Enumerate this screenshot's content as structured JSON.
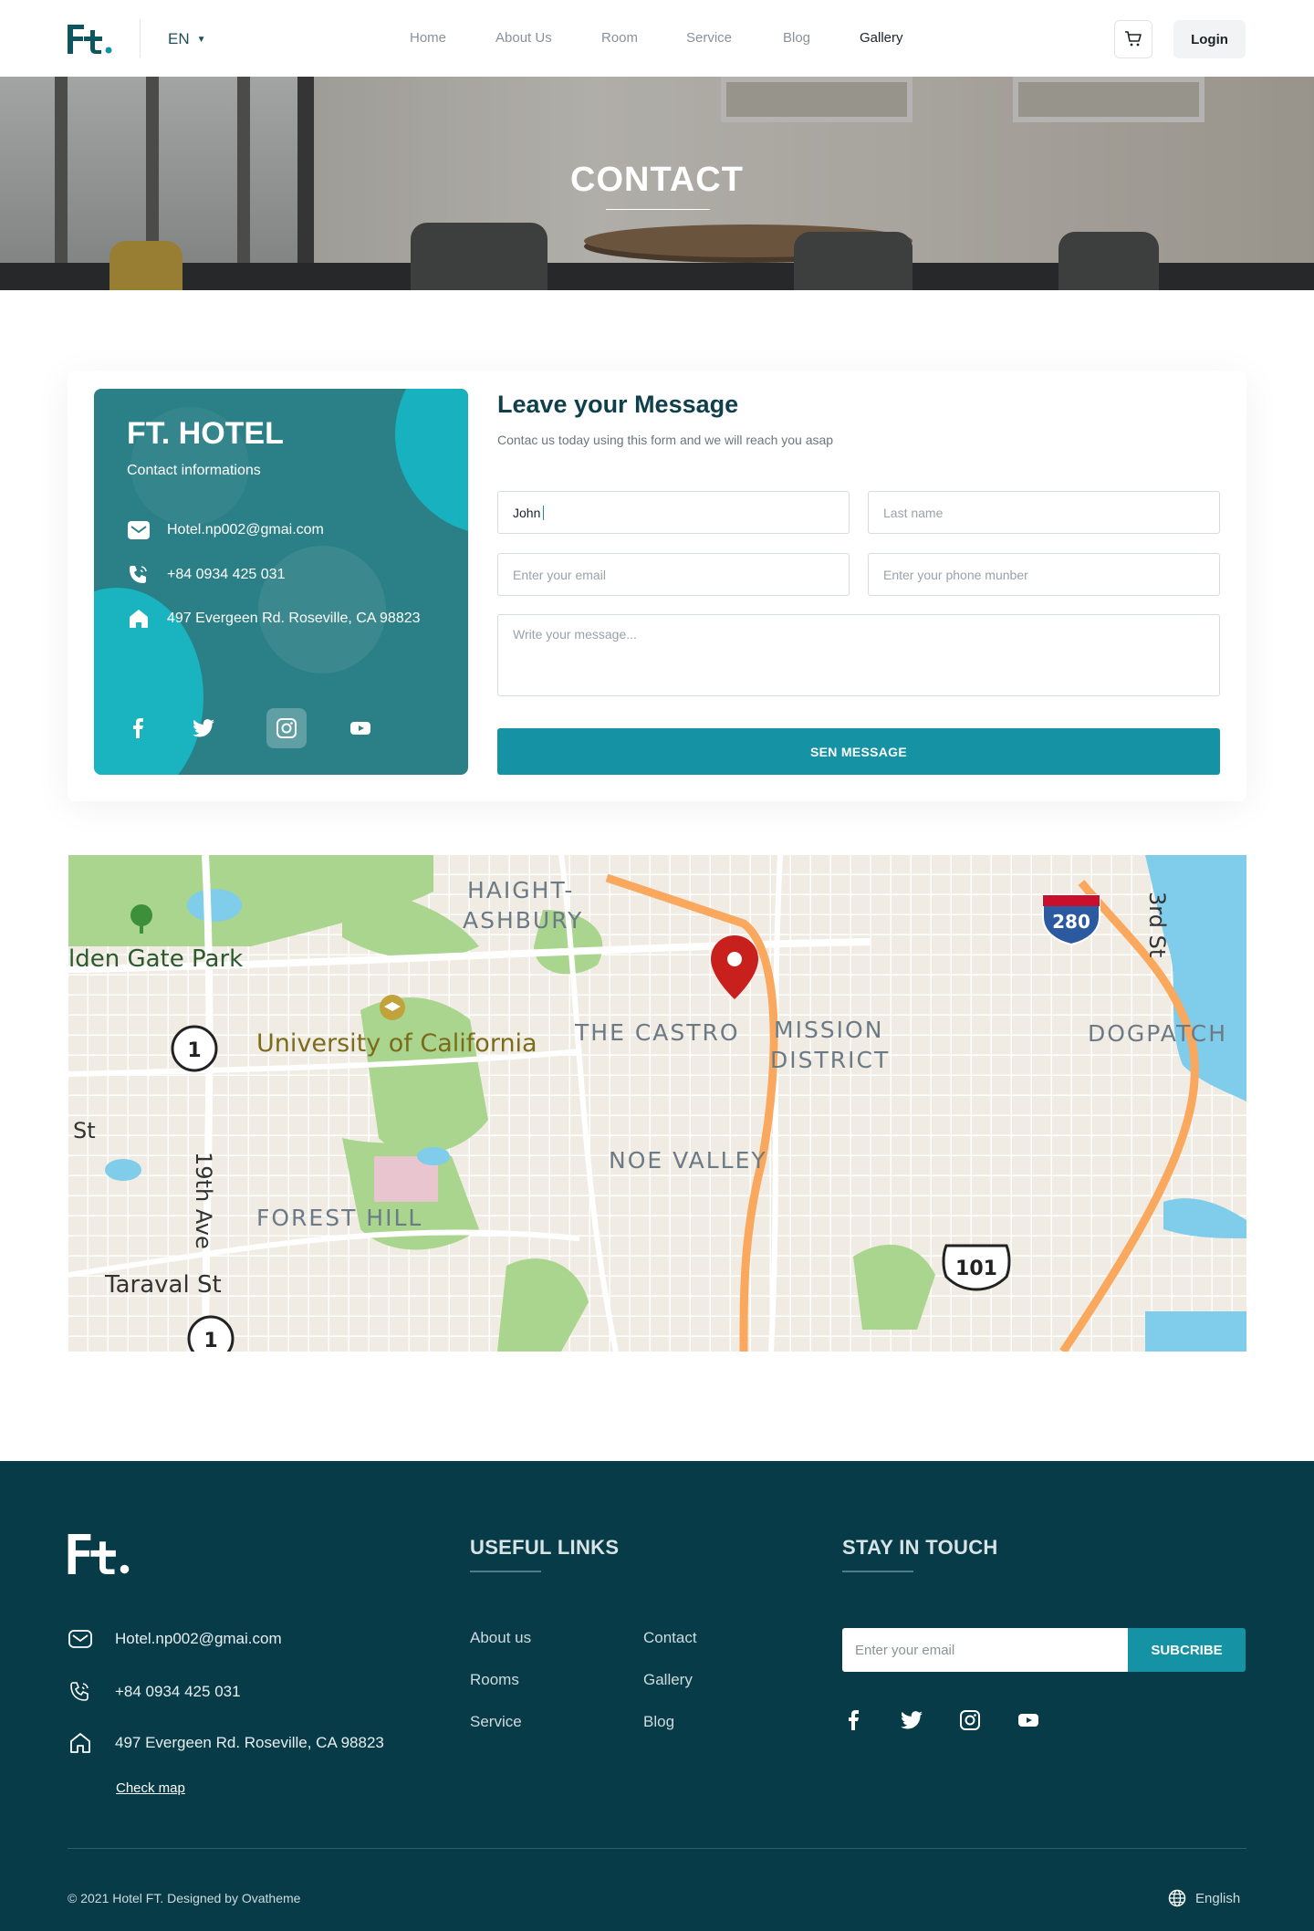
{
  "brand": {
    "logo_text": "Ft."
  },
  "header": {
    "language": "EN",
    "nav": [
      {
        "label": "Home",
        "active": false
      },
      {
        "label": "About Us",
        "active": false
      },
      {
        "label": "Room",
        "active": false
      },
      {
        "label": "Service",
        "active": false
      },
      {
        "label": "Blog",
        "active": false
      },
      {
        "label": "Gallery",
        "active": true
      }
    ],
    "cart_icon": "cart-icon",
    "login_label": "Login"
  },
  "hero": {
    "title": "CONTACT"
  },
  "contact_card": {
    "title": "FT. HOTEL",
    "subtitle": "Contact informations",
    "email": "Hotel.np002@gmai.com",
    "phone": "+84 0934 425 031",
    "address": "497 Evergeen Rd. Roseville, CA 98823",
    "social": [
      "facebook-icon",
      "twitter-icon",
      "instagram-icon",
      "youtube-icon"
    ],
    "active_social": "instagram-icon"
  },
  "form": {
    "title": "Leave your Message",
    "subtitle": "Contac us today using this form and we will reach you asap",
    "first_name_value": "John",
    "last_name_placeholder": "Last name",
    "email_placeholder": "Enter your email",
    "phone_placeholder": "Enter your phone munber",
    "message_placeholder": "Write your message...",
    "send_label": "SEN MESSAGE"
  },
  "map": {
    "labels": [
      "HAIGHT-",
      "ASHBURY",
      "lden Gate Park",
      "University of California",
      "THE CASTRO",
      "MISSION",
      "DISTRICT",
      "DOGPATCH",
      "NOE VALLEY",
      "FOREST HILL",
      "19th Ave",
      "Taraval St",
      "St",
      "3rd St"
    ],
    "shields": [
      "1",
      "1",
      "280",
      "101"
    ]
  },
  "footer": {
    "email": "Hotel.np002@gmai.com",
    "phone": "+84 0934 425 031",
    "address": "497 Evergeen Rd. Roseville, CA 98823",
    "check_map": "Check map",
    "useful_links_title": "USEFUL LINKS",
    "links_col1": [
      "About us",
      "Rooms",
      "Service"
    ],
    "links_col2": [
      "Contact",
      "Gallery",
      "Blog"
    ],
    "stay_title": "STAY IN TOUCH",
    "email_placeholder": "Enter your email",
    "subscribe_label": "SUBCRIBE",
    "copyright": "© 2021 Hotel FT. Designed by Ovatheme",
    "language": "English"
  },
  "colors": {
    "primary": "#1592a4",
    "dark": "#073b47",
    "card": "#2b7f86",
    "accent_cyan": "#17b1bf"
  }
}
